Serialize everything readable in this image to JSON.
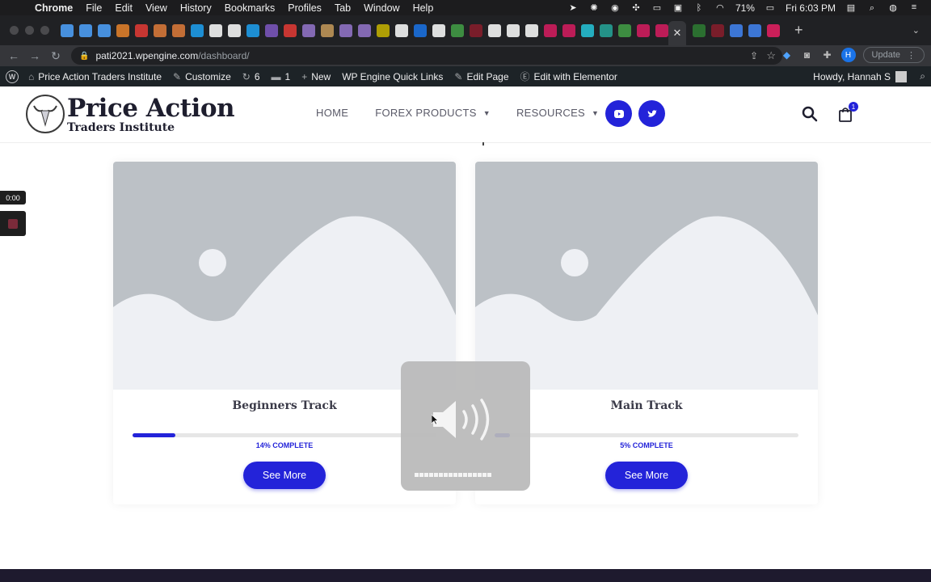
{
  "menubar": {
    "apple": "",
    "app": "Chrome",
    "items": [
      "File",
      "Edit",
      "View",
      "History",
      "Bookmarks",
      "Profiles",
      "Tab",
      "Window",
      "Help"
    ],
    "battery": "71%",
    "clock": "Fri 6:03 PM"
  },
  "tabs": {
    "active_close": "✕",
    "new_tab": "+",
    "menu": "⌄",
    "favicon_colors": [
      "#4fa3ff",
      "#4fa3ff",
      "#4fa3ff",
      "#e8832a",
      "#e53935",
      "#e07b39",
      "#e07b39",
      "#1da1f2",
      "#ffffff",
      "#ffffff",
      "#1da1f2",
      "#7e57c2",
      "#e53935",
      "#9575cd",
      "#c79a5b",
      "#9575cd",
      "#9575cd",
      "#c8b400",
      "#ffffff",
      "#1a73e8",
      "#ffffff",
      "#43a047",
      "#8a1c2b",
      "#ffffff",
      "#ffffff",
      "#ffffff",
      "#d81b60",
      "#d81b60",
      "#26c6da",
      "#26a69a",
      "#43a047",
      "#d81b60",
      "#d81b60",
      "#2e7d32",
      "#8a1c2b",
      "#4285f4",
      "#4285f4",
      "#e91e63"
    ]
  },
  "address": {
    "host": "pati2021.wpengine.com",
    "path": "/dashboard/",
    "profile_initial": "H",
    "update_label": "Update"
  },
  "wpbar": {
    "site_name": "Price Action Traders Institute",
    "customize": "Customize",
    "updates_count": "6",
    "comments_count": "1",
    "new_label": "New",
    "quick_links": "WP Engine Quick Links",
    "edit_page": "Edit Page",
    "edit_elementor": "Edit with Elementor",
    "howdy": "Howdy, Hannah S"
  },
  "header": {
    "logo_title": "Price Action",
    "logo_subtitle": "Traders Institute",
    "nav": [
      {
        "label": "HOME",
        "dropdown": false
      },
      {
        "label": "FOREX PRODUCTS",
        "dropdown": true
      },
      {
        "label": "RESOURCES",
        "dropdown": true
      }
    ],
    "cart_count": "1",
    "brand_color": "#2323d9"
  },
  "cards": [
    {
      "title": "Beginners Track",
      "progress_percent": 14,
      "progress_label": "14% COMPLETE",
      "button_label": "See More"
    },
    {
      "title": "Main Track",
      "progress_percent": 5,
      "progress_label": "5% COMPLETE",
      "button_label": "See More"
    }
  ],
  "recorder": {
    "time": "0:00"
  },
  "volume_hud": {
    "icon": "speaker-volume-icon",
    "level_segments": 0,
    "total_segments": 16
  }
}
